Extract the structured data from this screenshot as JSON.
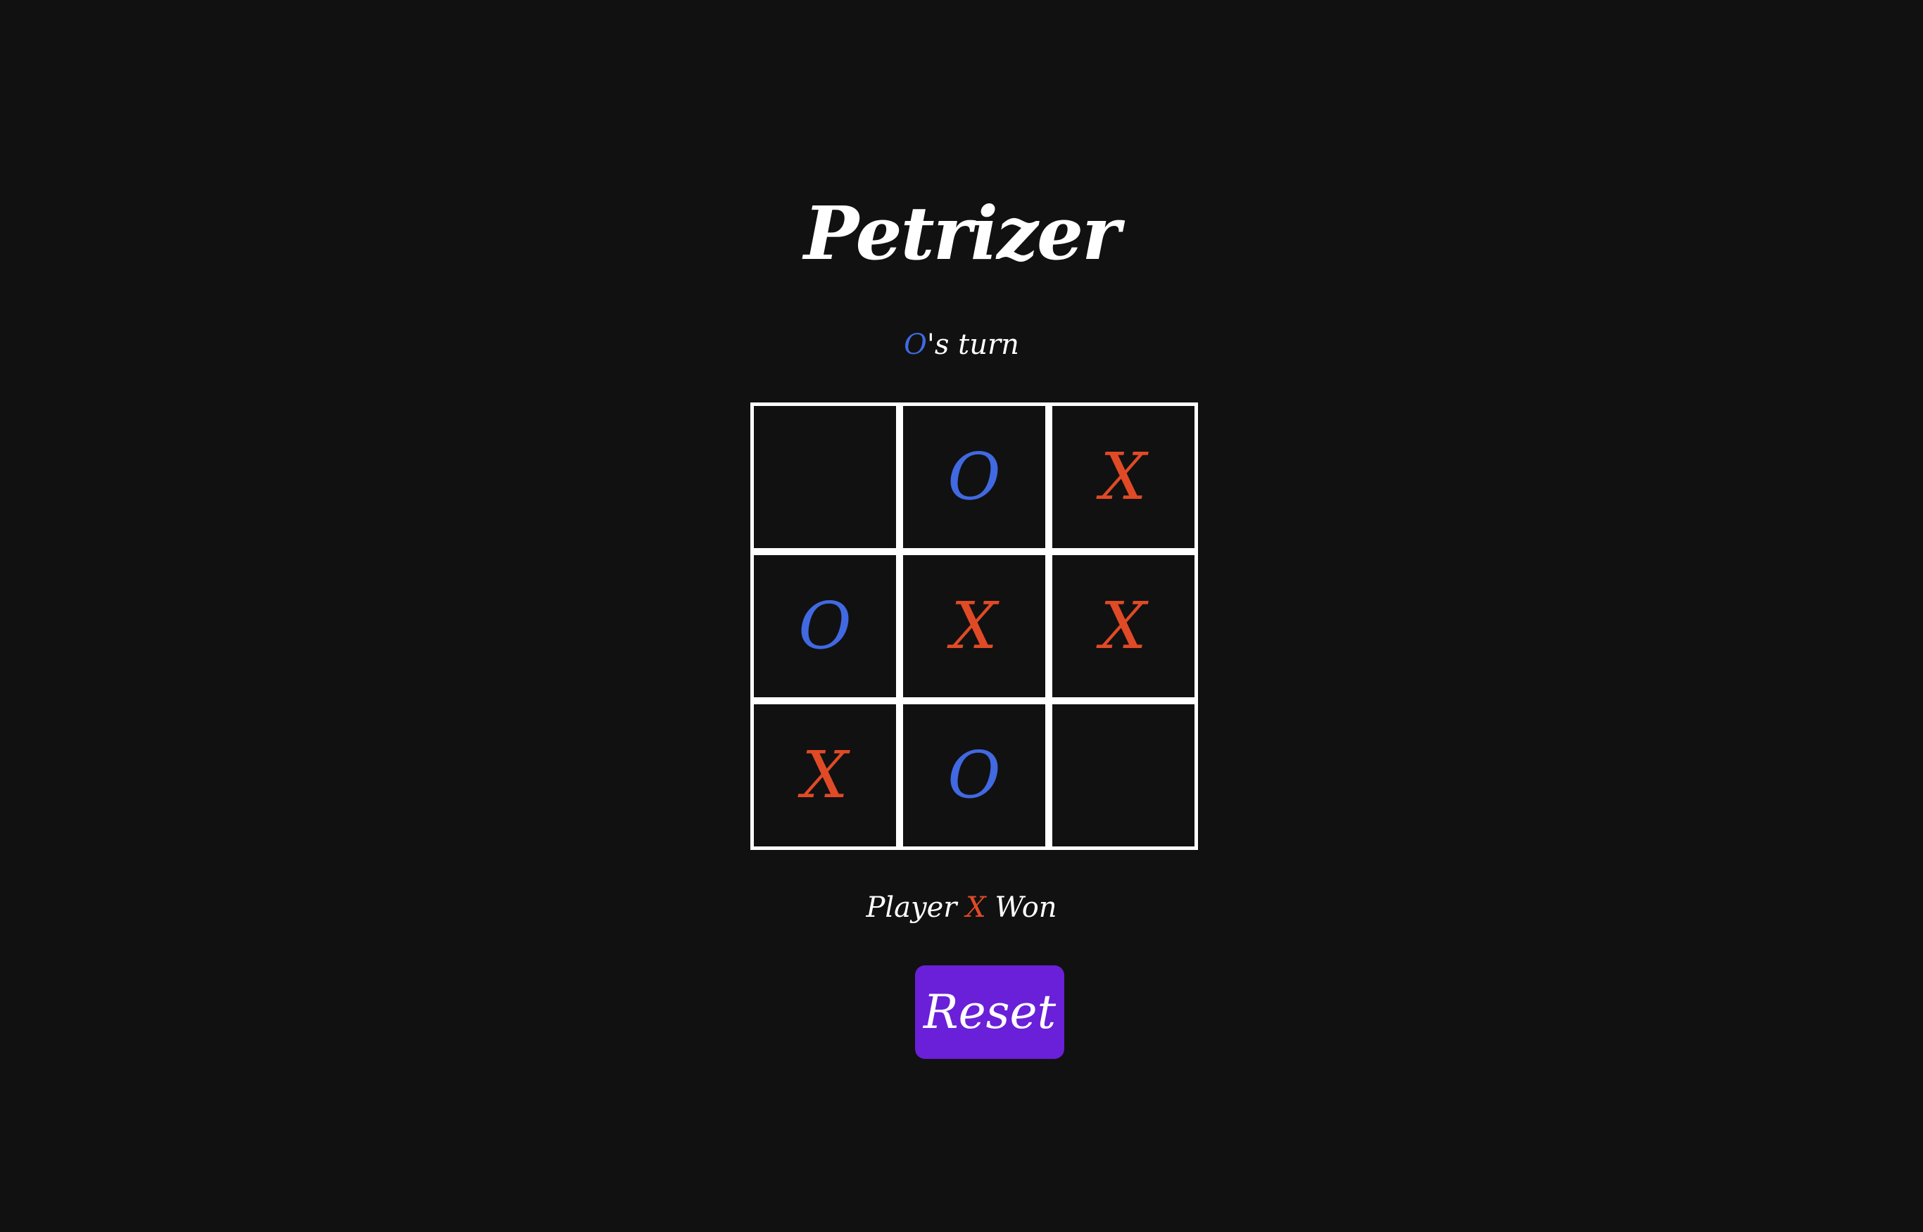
{
  "title": "Petrizer",
  "turn": {
    "mark": "O",
    "text": "'s turn"
  },
  "board": [
    "",
    "O",
    "X",
    "O",
    "X",
    "X",
    "X",
    "O",
    ""
  ],
  "status": {
    "prefix": "Player",
    "mark": "X",
    "suffix": "Won"
  },
  "reset_label": "Reset",
  "colors": {
    "background": "#111111",
    "x": "#e04a26",
    "o": "#4169e1",
    "reset_button": "#6a1fd8",
    "grid": "#ffffff"
  }
}
